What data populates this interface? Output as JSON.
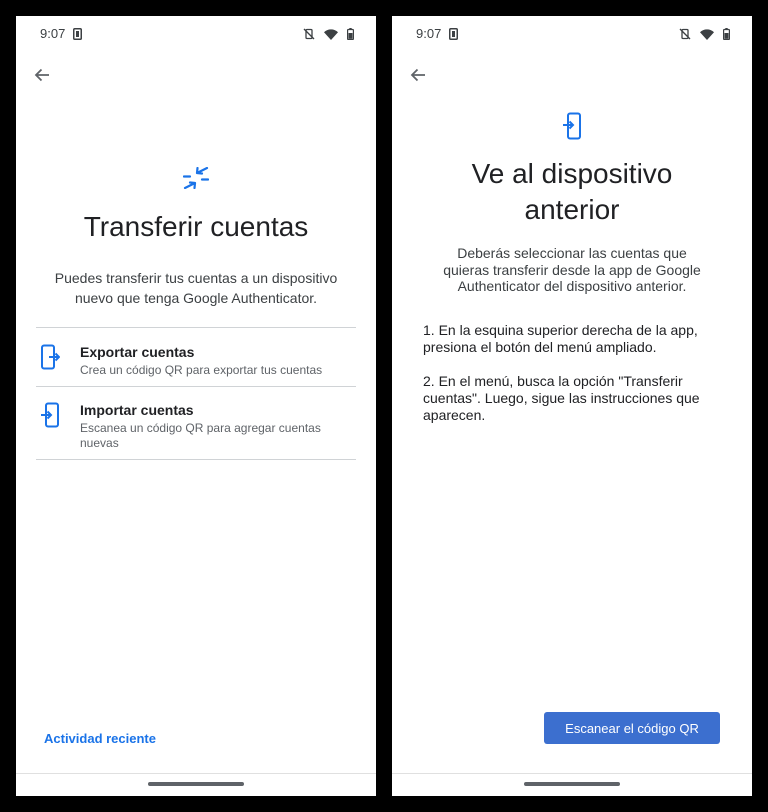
{
  "colors": {
    "accent": "#1a73e8",
    "button": "#3c6fcf",
    "text": "#202124",
    "secondary": "#5f6368"
  },
  "left": {
    "status": {
      "time": "9:07"
    },
    "icons": {
      "back": "arrow-back-icon",
      "hero": "transfer-arrows-icon"
    },
    "title": "Transferir cuentas",
    "description": "Puedes transferir tus cuentas a un dispositivo nuevo que tenga Google Authenticator.",
    "options": [
      {
        "icon": "phone-export-icon",
        "title": "Exportar cuentas",
        "subtitle": "Crea un código QR para exportar tus cuentas"
      },
      {
        "icon": "phone-import-icon",
        "title": "Importar cuentas",
        "subtitle": "Escanea un código QR para agregar cuentas nuevas"
      }
    ],
    "recent_activity": "Actividad reciente"
  },
  "right": {
    "status": {
      "time": "9:07"
    },
    "icons": {
      "back": "arrow-back-icon",
      "hero": "phone-import-icon"
    },
    "title_line1": "Ve al dispositivo",
    "title_line2": "anterior",
    "description": "Deberás seleccionar las cuentas que quieras transferir desde la app de Google Authenticator del dispositivo anterior.",
    "steps": [
      "1. En la esquina superior derecha de la app, presiona el botón del menú ampliado.",
      "2. En el menú, busca la opción \"Transferir cuentas\". Luego, sigue las instrucciones que aparecen."
    ],
    "scan_button": "Escanear el código QR"
  }
}
